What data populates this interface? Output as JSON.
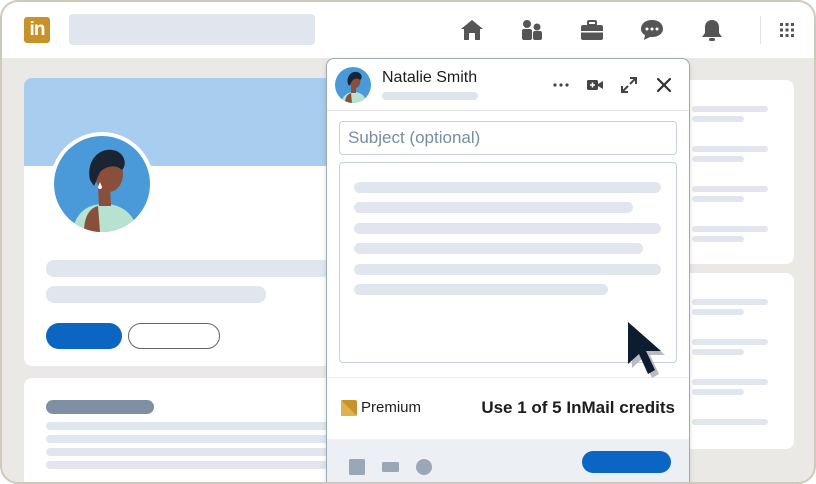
{
  "nav": {
    "logo_text": "in",
    "icons": [
      "home-icon",
      "people-icon",
      "briefcase-icon",
      "messaging-icon",
      "bell-icon",
      "grid-icon"
    ]
  },
  "message": {
    "recipient_name": "Natalie Smith",
    "subject_placeholder": "Subject (optional)",
    "premium_label": "Premium",
    "credits_text": "Use 1 of 5 InMail credits",
    "header_icons": [
      "more-icon",
      "video-icon",
      "expand-icon",
      "close-icon"
    ],
    "footer_icons": [
      "image-icon",
      "attachment-icon",
      "emoji-icon"
    ]
  },
  "colors": {
    "brand_blue": "#0a66c2",
    "logo_gold": "#c8922a",
    "cover_blue": "#a9cdee",
    "nav_icon": "#555555"
  }
}
